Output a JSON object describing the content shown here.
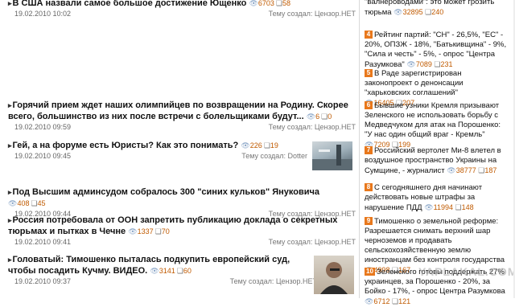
{
  "left_news": [
    {
      "title": "В США назвали самое большое достижение Ющенко",
      "views": "6703",
      "comments": "58",
      "date": "19.02.2010 10:02",
      "creator": "Тему создал: Цензор.НЕТ"
    },
    {
      "title": "Горячий прием ждет наших олимпийцев по возвращении на Родину. Скорее всего, большинство из них после встречи с болельщиками будут...",
      "views": "6",
      "comments": "0",
      "date": "19.02.2010 09:59",
      "creator": "Тему создал: Цензор.НЕТ"
    },
    {
      "title": "Гей, а на форуме есть Юристы? Как это понимать?",
      "views": "226",
      "comments": "19",
      "date": "19.02.2010 09:45",
      "creator": "Тему создал: Dotter"
    },
    {
      "title": "Под Высшим админсудом собралось 300 \"синих кульков\" Януковича",
      "views": "408",
      "comments": "45",
      "date": "19.02.2010 09:44",
      "creator": "Тему создал: Цензор.НЕТ"
    },
    {
      "title": "Россия потребовала от ООН запретить публикацию доклада о секретных тюрьмах и пытках в Чечне",
      "views": "1337",
      "comments": "70",
      "date": "19.02.2010 09:41",
      "creator": "Тему создал: Цензор.НЕТ"
    },
    {
      "title": "Головатый: Тимошенко пыталась подкупить европейский суд, чтобы посадить Кучму. ВИДЕО.",
      "views": "3141",
      "comments": "60",
      "date": "19.02.2010 09:37",
      "creator": "Тему создал: Цензор.НЕТ"
    }
  ],
  "right_news": [
    {
      "num": "",
      "title": "\"валнероводами\": это может грозить тюрьма",
      "views": "32895",
      "comments": "240"
    },
    {
      "num": "4",
      "title": "Рейтинг партий: \"СН\" - 26,5%, \"ЕС\" - 20%, ОПЗЖ - 18%, \"Батькивщина\" - 9%, \"Сила и честь\" - 5%, - опрос \"Центра Разумкова\"",
      "views": "7089",
      "comments": "231"
    },
    {
      "num": "5",
      "title": "В Раде зарегистрирован законопроект о денонсации \"харьковских соглашений\"",
      "views": "16405",
      "comments": "207"
    },
    {
      "num": "6",
      "title": "Бывшие узники Кремля призывают Зеленского не использовать борьбу с Медведчуком для атак на Порошенко: \"У нас один общий враг - Кремль\"",
      "views": "7209",
      "comments": "199"
    },
    {
      "num": "7",
      "title": "Российский вертолет Ми-8 влетел в воздушное пространство Украины на Сумщине, - журналист",
      "views": "38777",
      "comments": "187"
    },
    {
      "num": "8",
      "title": "С сегодняшнего дня начинают действовать новые штрафы за нарушение ПДД",
      "views": "11994",
      "comments": "148"
    },
    {
      "num": "9",
      "title": "Тимошенко о земельной реформе: Разрешается снимать верхний шар черноземов и продавать сельскохозяйственную землю иностранцам без контроля государства",
      "views": "4998",
      "comments": "167"
    },
    {
      "num": "10",
      "title": "Зеленского готовы поддержать 27% украинцев, за Порошенко - 20%, за Бойко - 17%, - опрос Центра Разумкова",
      "views": "6712",
      "comments": "121"
    }
  ],
  "watermark": "YAPLAKAL.COM",
  "colors": {
    "accent": "#e8781c",
    "views": "#c05a00",
    "meta": "#666666"
  }
}
